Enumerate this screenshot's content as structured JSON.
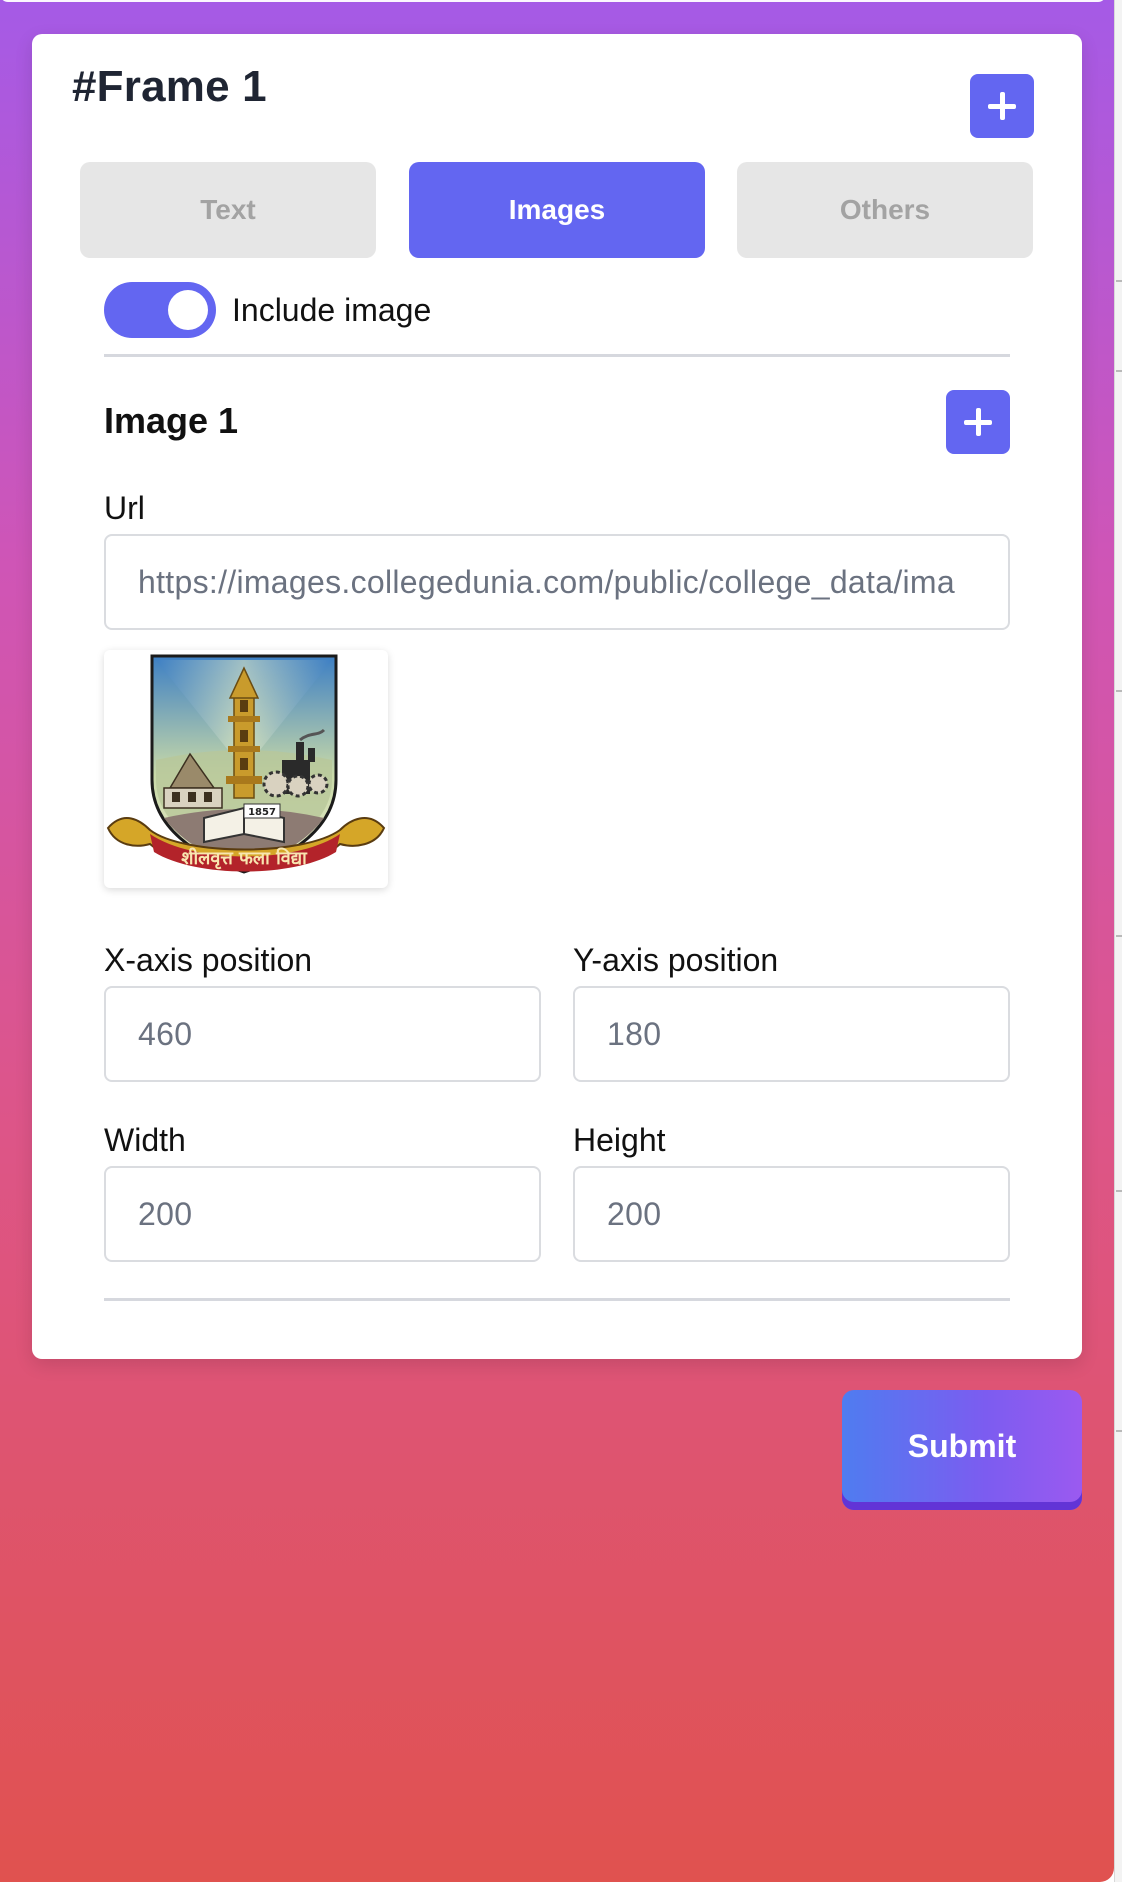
{
  "frame": {
    "title": "#Frame 1"
  },
  "tabs": [
    {
      "label": "Text",
      "active": false
    },
    {
      "label": "Images",
      "active": true
    },
    {
      "label": "Others",
      "active": false
    }
  ],
  "include_image": {
    "label": "Include image",
    "enabled": true
  },
  "image": {
    "title": "Image 1",
    "url_label": "Url",
    "url_value": "https://images.collegedunia.com/public/college_data/ima",
    "x_label": "X-axis position",
    "x_value": "460",
    "y_label": "Y-axis position",
    "y_value": "180",
    "width_label": "Width",
    "width_value": "200",
    "height_label": "Height",
    "height_value": "200",
    "preview": {
      "year": "1857",
      "motto": "शीलवृत्त फला विद्या"
    }
  },
  "submit_label": "Submit",
  "colors": {
    "accent": "#6366f1",
    "tab_inactive": "#e6e6e6",
    "gradient_top": "#a55ae6",
    "gradient_bottom": "#e0524f"
  }
}
